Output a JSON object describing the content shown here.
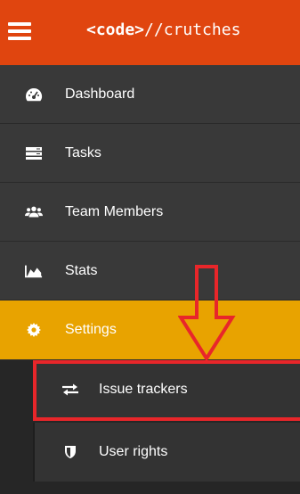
{
  "app": {
    "brand_code": "<code>",
    "brand_rest": "//crutches"
  },
  "menu": {
    "items": [
      {
        "label": "Dashboard",
        "icon": "tachometer-icon"
      },
      {
        "label": "Tasks",
        "icon": "server-icon"
      },
      {
        "label": "Team Members",
        "icon": "users-icon"
      },
      {
        "label": "Stats",
        "icon": "area-chart-icon"
      },
      {
        "label": "Settings",
        "icon": "gear-icon",
        "active": true
      }
    ]
  },
  "submenu": {
    "items": [
      {
        "label": "Issue trackers",
        "icon": "exchange-icon",
        "highlighted": true
      },
      {
        "label": "User rights",
        "icon": "shield-icon"
      }
    ]
  },
  "colors": {
    "header": "#e0450f",
    "active": "#e8a300",
    "menu_bg": "#393939",
    "annotation": "#e8262a"
  }
}
